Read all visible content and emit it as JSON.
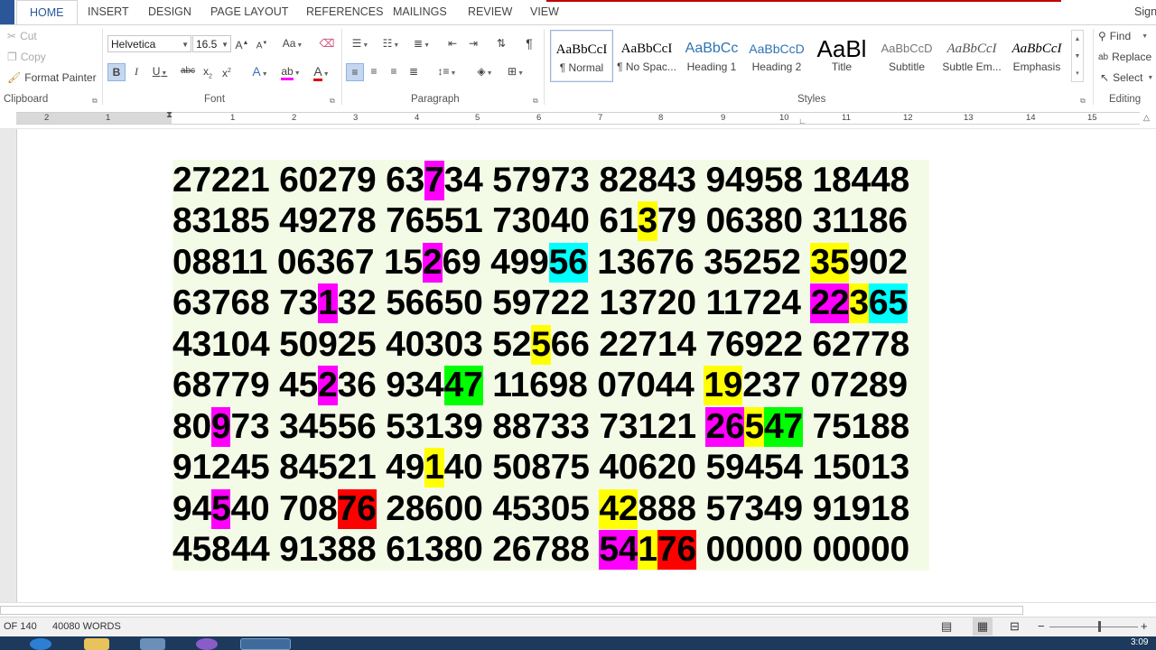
{
  "tabs": [
    "HOME",
    "INSERT",
    "DESIGN",
    "PAGE LAYOUT",
    "REFERENCES",
    "MAILINGS",
    "REVIEW",
    "VIEW"
  ],
  "user_label": "Sign",
  "clipboard": {
    "cut": "Cut",
    "copy": "Copy",
    "format_painter": "Format Painter",
    "label": "Clipboard"
  },
  "font": {
    "name": "Helvetica",
    "size": "16.5",
    "label": "Font"
  },
  "paragraph": {
    "label": "Paragraph"
  },
  "styles": {
    "label": "Styles",
    "items": [
      {
        "preview": "AaBbCcI",
        "name": "¶ Normal"
      },
      {
        "preview": "AaBbCcI",
        "name": "¶ No Spac..."
      },
      {
        "preview": "AaBbCc",
        "name": "Heading 1"
      },
      {
        "preview": "AaBbCcD",
        "name": "Heading 2"
      },
      {
        "preview": "AaBl",
        "name": "Title"
      },
      {
        "preview": "AaBbCcD",
        "name": "Subtitle"
      },
      {
        "preview": "AaBbCcI",
        "name": "Subtle Em..."
      },
      {
        "preview": "AaBbCcI",
        "name": "Emphasis"
      }
    ]
  },
  "editing": {
    "find": "Find",
    "replace": "Replace",
    "select": "Select",
    "label": "Editing"
  },
  "ruler_numbers": [
    "2",
    "1",
    "1",
    "2",
    "3",
    "4",
    "5",
    "6",
    "7",
    "8",
    "9",
    "10",
    "11",
    "12",
    "13",
    "14",
    "15"
  ],
  "document": {
    "rows": [
      [
        {
          "t": "27221 60279 63"
        },
        {
          "t": "7",
          "h": "m"
        },
        {
          "t": "34 57973 82843 94958 18448"
        }
      ],
      [
        {
          "t": "83185 49278 76551 73040 61"
        },
        {
          "t": "3",
          "h": "y"
        },
        {
          "t": "79 06380 31186"
        }
      ],
      [
        {
          "t": "08811 06367 15"
        },
        {
          "t": "2",
          "h": "m"
        },
        {
          "t": "69 499"
        },
        {
          "t": "56",
          "h": "c"
        },
        {
          "t": " 13676 35252 "
        },
        {
          "t": "35",
          "h": "y"
        },
        {
          "t": "902"
        }
      ],
      [
        {
          "t": "63768 73"
        },
        {
          "t": "1",
          "h": "m"
        },
        {
          "t": "32 56650 59722 13720 11724 "
        },
        {
          "t": "22",
          "h": "m"
        },
        {
          "t": "3",
          "h": "y"
        },
        {
          "t": "65",
          "h": "c"
        }
      ],
      [
        {
          "t": "43104 50925 40303 52"
        },
        {
          "t": "5",
          "h": "y"
        },
        {
          "t": "66 22714 76922 62778"
        }
      ],
      [
        {
          "t": "68779 45"
        },
        {
          "t": "2",
          "h": "m"
        },
        {
          "t": "36 934"
        },
        {
          "t": "47",
          "h": "g"
        },
        {
          "t": " 11698 07044 "
        },
        {
          "t": "19",
          "h": "y"
        },
        {
          "t": "237 07289"
        }
      ],
      [
        {
          "t": "80"
        },
        {
          "t": "9",
          "h": "m"
        },
        {
          "t": "73 34556 53139 88733 73121 "
        },
        {
          "t": "26",
          "h": "m"
        },
        {
          "t": "5",
          "h": "y"
        },
        {
          "t": "47",
          "h": "g"
        },
        {
          "t": " 75188"
        }
      ],
      [
        {
          "t": "91245 84521 49"
        },
        {
          "t": "1",
          "h": "y"
        },
        {
          "t": "40 50875 40620 59454 15013"
        }
      ],
      [
        {
          "t": "94"
        },
        {
          "t": "5",
          "h": "m"
        },
        {
          "t": "40 708"
        },
        {
          "t": "76",
          "h": "r"
        },
        {
          "t": " 28600 45305 "
        },
        {
          "t": "42",
          "h": "y"
        },
        {
          "t": "888 57349 91918"
        }
      ],
      [
        {
          "t": "45844 91388 61380 26788 "
        },
        {
          "t": "54",
          "h": "m"
        },
        {
          "t": "1",
          "h": "y"
        },
        {
          "t": "76",
          "h": "r"
        },
        {
          "t": " 00000 00000"
        }
      ]
    ]
  },
  "status": {
    "page": "OF 140",
    "words": "40080 WORDS"
  },
  "taskbar": {
    "clock": "3:09"
  },
  "colors": {
    "accent": "#2b579a",
    "doc_bg": "#f3fbe7",
    "magenta": "#ff00ff",
    "yellow": "#ffff00",
    "cyan": "#00ffff",
    "green": "#00ff00",
    "red": "#ff0000"
  }
}
